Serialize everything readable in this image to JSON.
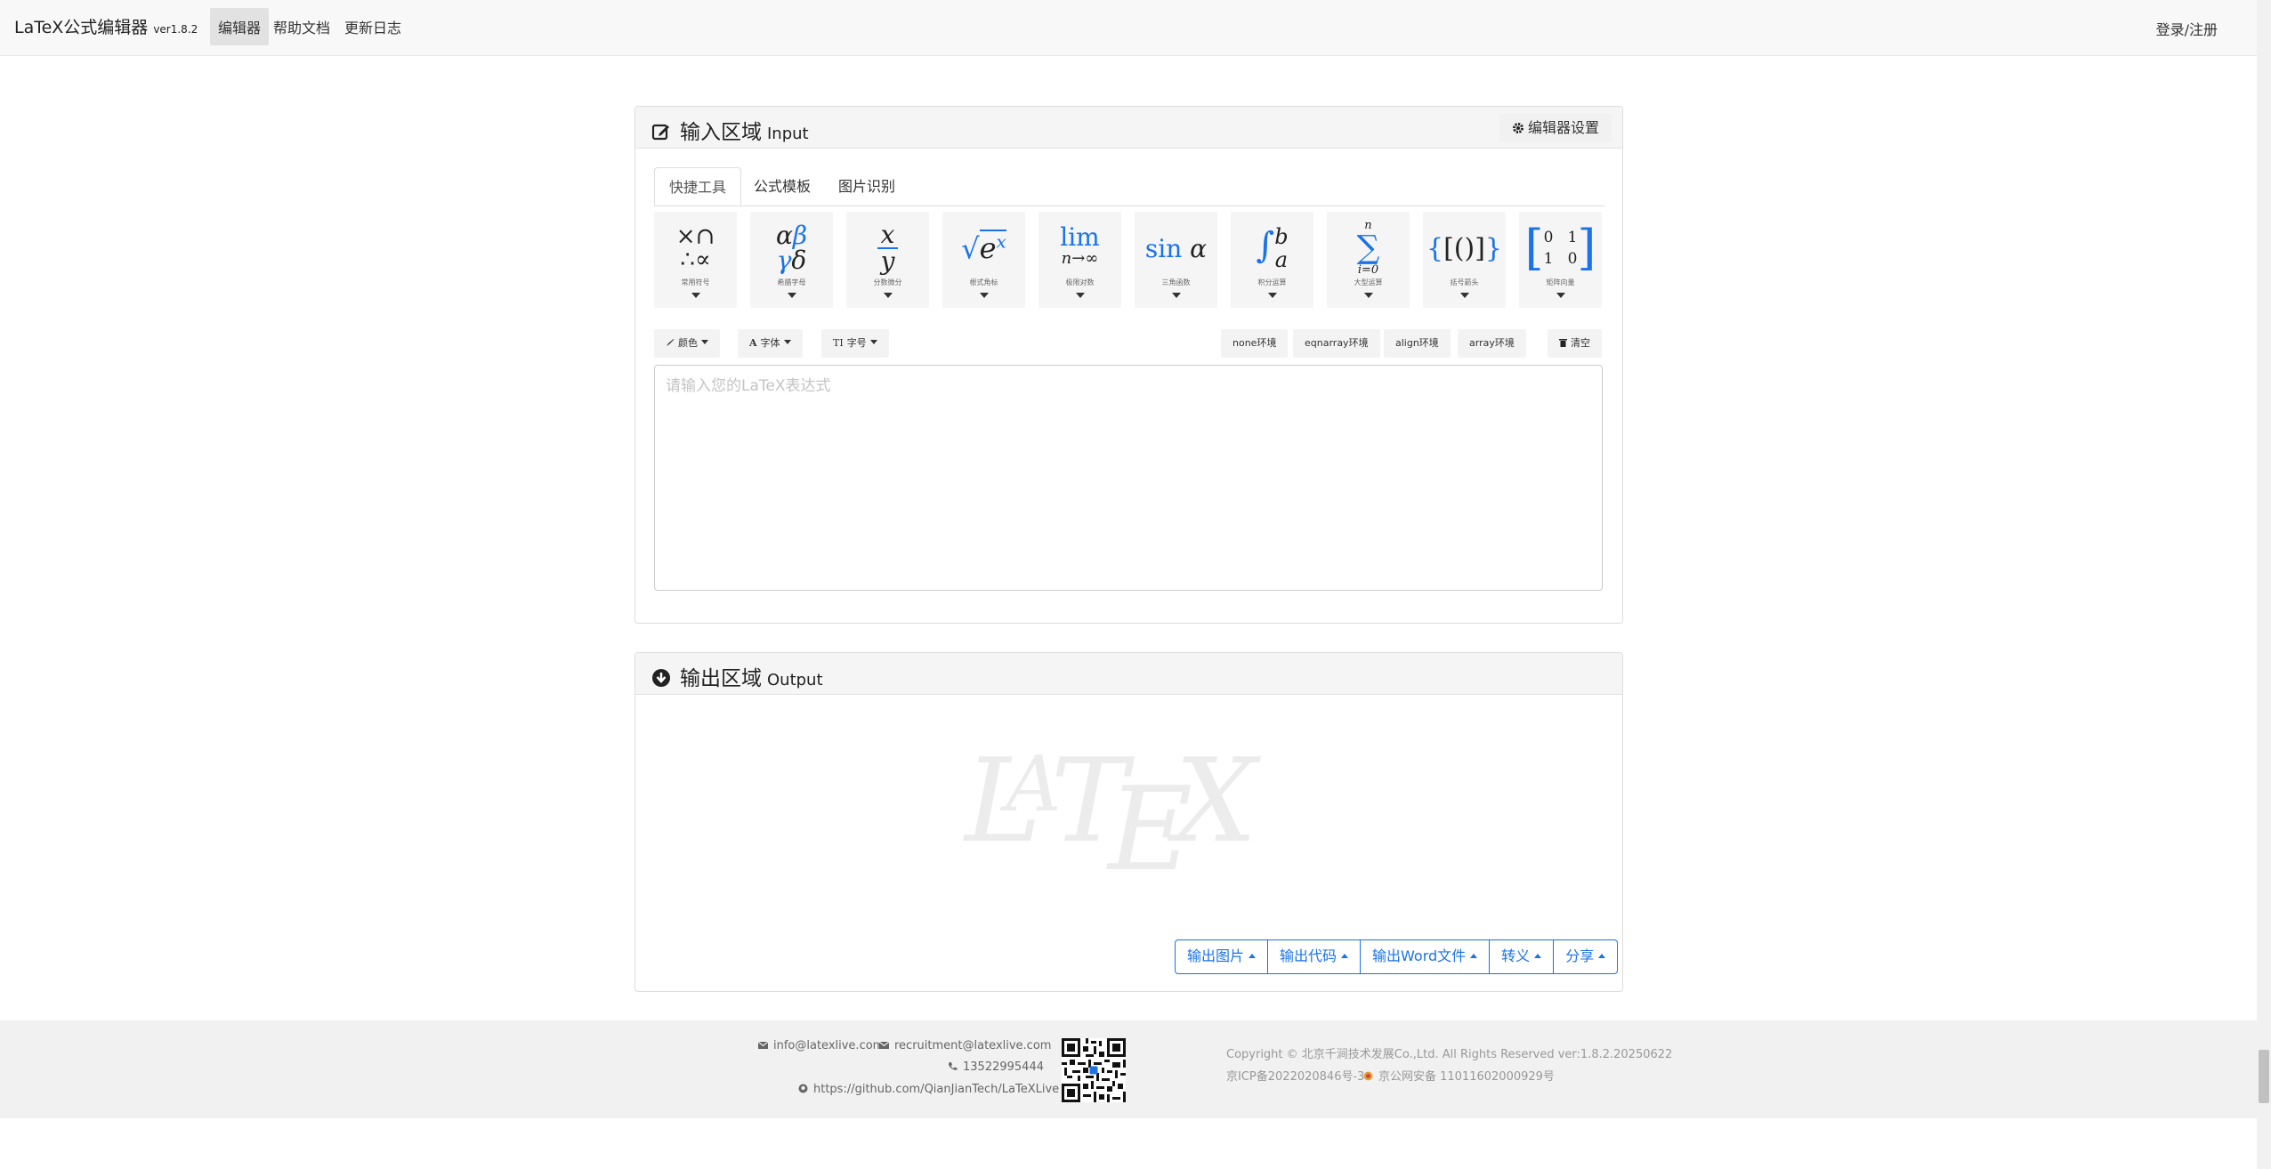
{
  "navbar": {
    "brand": "LaTeX公式编辑器",
    "version": "ver1.8.2",
    "links": [
      "编辑器",
      "帮助文档",
      "更新日志"
    ],
    "login": "登录/注册"
  },
  "input_panel": {
    "title_cn": "输入区域",
    "title_en": "Input",
    "settings_label": "编辑器设置",
    "tabs": [
      "快捷工具",
      "公式模板",
      "图片识别"
    ],
    "tiles": [
      {
        "caption": "常用符号"
      },
      {
        "caption": "希腊字母"
      },
      {
        "caption": "分数微分"
      },
      {
        "caption": "根式角标"
      },
      {
        "caption": "极限对数"
      },
      {
        "caption": "三角函数"
      },
      {
        "caption": "积分运算"
      },
      {
        "caption": "大型运算"
      },
      {
        "caption": "括号箭头"
      },
      {
        "caption": "矩阵向量"
      }
    ],
    "toolbar": {
      "color": "颜色",
      "font": "字体",
      "size": "字号",
      "env_none": "none环境",
      "env_eqnarray": "eqnarray环境",
      "env_align": "align环境",
      "env_array": "array环境",
      "clear": "清空"
    },
    "editor_placeholder": "请输入您的LaTeX表达式"
  },
  "output_panel": {
    "title_cn": "输出区域",
    "title_en": "Output",
    "buttons": [
      "输出图片",
      "输出代码",
      "输出Word文件",
      "转义",
      "分享"
    ]
  },
  "footer": {
    "email_info": "info@latexlive.com",
    "email_recruit": "recruitment@latexlive.com",
    "phone": "13522995444",
    "github": "https://github.com/QianJianTech/LaTeXLive",
    "copyright": "Copyright © 北京千涧技术发展Co.,Ltd. All Rights Reserved  ver:1.8.2.20250622",
    "icp": "京ICP备2022020846号-3",
    "police": "京公网安备 11011602000929号"
  },
  "colors": {
    "accent": "#1a73e8",
    "navbar_bg": "#f8f8f8",
    "footer_bg": "#f1f1f1"
  }
}
